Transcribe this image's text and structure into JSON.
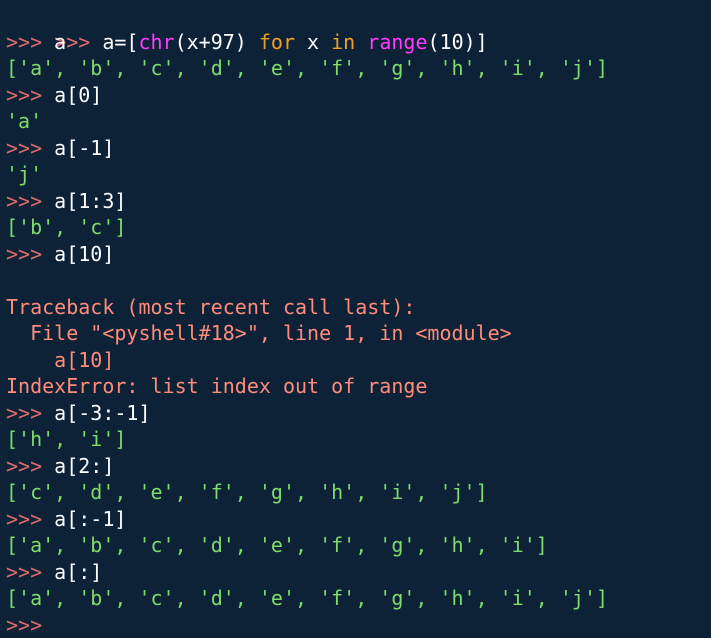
{
  "colors": {
    "background": "#0d2137",
    "prompt": "#e06c6c",
    "code": "#ffffff",
    "keyword": "#f0a020",
    "builtin": "#ff3cff",
    "string_output": "#7ddc6a",
    "error": "#ff8c7a"
  },
  "prompt": ">>>",
  "lines": [
    {
      "type": "input_rich",
      "p1": " a=[",
      "p2": "chr",
      "p3": "(x+97) ",
      "p4": "for",
      "p5": " x ",
      "p6": "in",
      "p7": " ",
      "p8": "range",
      "p9": "(10)]"
    },
    {
      "type": "input",
      "code": " a"
    },
    {
      "type": "output",
      "text": "['a', 'b', 'c', 'd', 'e', 'f', 'g', 'h', 'i', 'j']"
    },
    {
      "type": "input",
      "code": " a[0]"
    },
    {
      "type": "output",
      "text": "'a'"
    },
    {
      "type": "input",
      "code": " a[-1]"
    },
    {
      "type": "output",
      "text": "'j'"
    },
    {
      "type": "input",
      "code": " a[1:3]"
    },
    {
      "type": "output",
      "text": "['b', 'c']"
    },
    {
      "type": "input",
      "code": " a[10]"
    },
    {
      "type": "blank",
      "text": ""
    },
    {
      "type": "error",
      "text": "Traceback (most recent call last):"
    },
    {
      "type": "error",
      "text": "  File \"<pyshell#18>\", line 1, in <module>"
    },
    {
      "type": "error",
      "text": "    a[10]"
    },
    {
      "type": "error",
      "text": "IndexError: list index out of range"
    },
    {
      "type": "input",
      "code": " a[-3:-1]"
    },
    {
      "type": "output",
      "text": "['h', 'i']"
    },
    {
      "type": "input",
      "code": " a[2:]"
    },
    {
      "type": "output",
      "text": "['c', 'd', 'e', 'f', 'g', 'h', 'i', 'j']"
    },
    {
      "type": "input",
      "code": " a[:-1]"
    },
    {
      "type": "output",
      "text": "['a', 'b', 'c', 'd', 'e', 'f', 'g', 'h', 'i']"
    },
    {
      "type": "input",
      "code": " a[:]"
    },
    {
      "type": "output",
      "text": "['a', 'b', 'c', 'd', 'e', 'f', 'g', 'h', 'i', 'j']"
    },
    {
      "type": "input",
      "code": ""
    }
  ]
}
